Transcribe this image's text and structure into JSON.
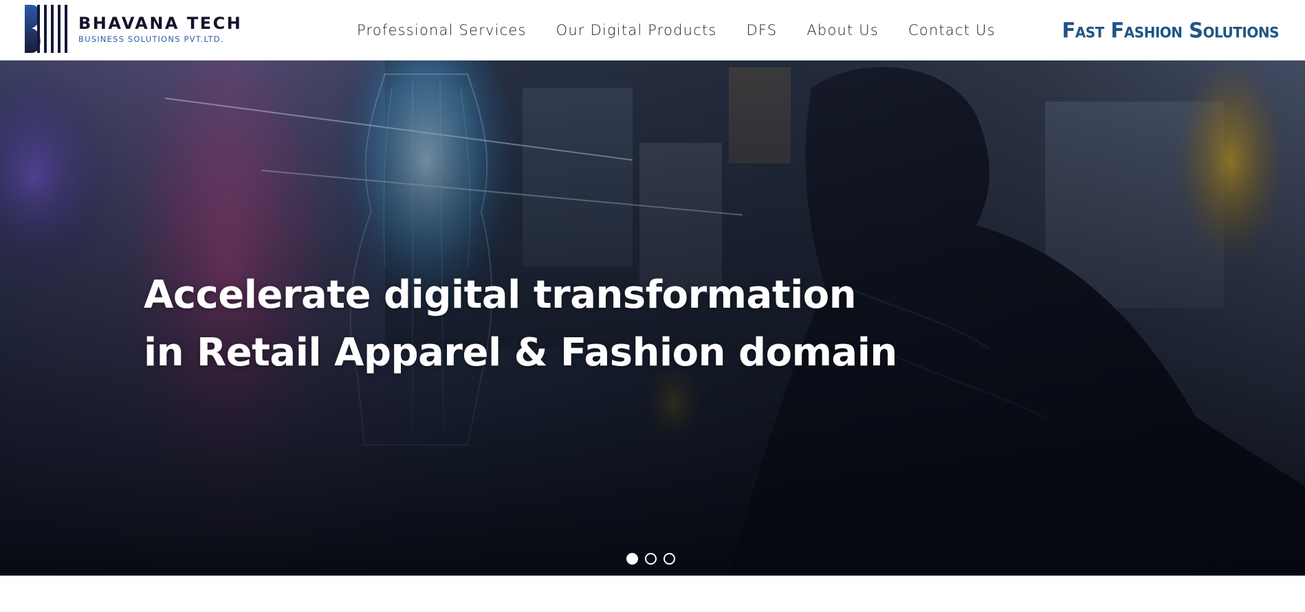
{
  "header": {
    "logo": {
      "title": "BHAVANA TECH",
      "subtitle": "BUSINESS SOLUTIONS PVT.LTD.",
      "icon": "bhavana-logo-mark"
    },
    "nav": [
      {
        "label": "Professional Services"
      },
      {
        "label": "Our Digital Products"
      },
      {
        "label": "DFS"
      },
      {
        "label": "About Us"
      },
      {
        "label": "Contact Us"
      }
    ],
    "partner_brand": "Fast Fashion Solutions"
  },
  "hero": {
    "heading_line1": "Accelerate digital transformation",
    "heading_line2": "in Retail Apparel & Fashion domain",
    "slides_total": 3,
    "active_slide": 1
  },
  "colors": {
    "logo_dark": "#12122a",
    "logo_blue": "#2a5fa8",
    "brand_blue": "#1f5585",
    "hero_text": "#ffffff"
  }
}
